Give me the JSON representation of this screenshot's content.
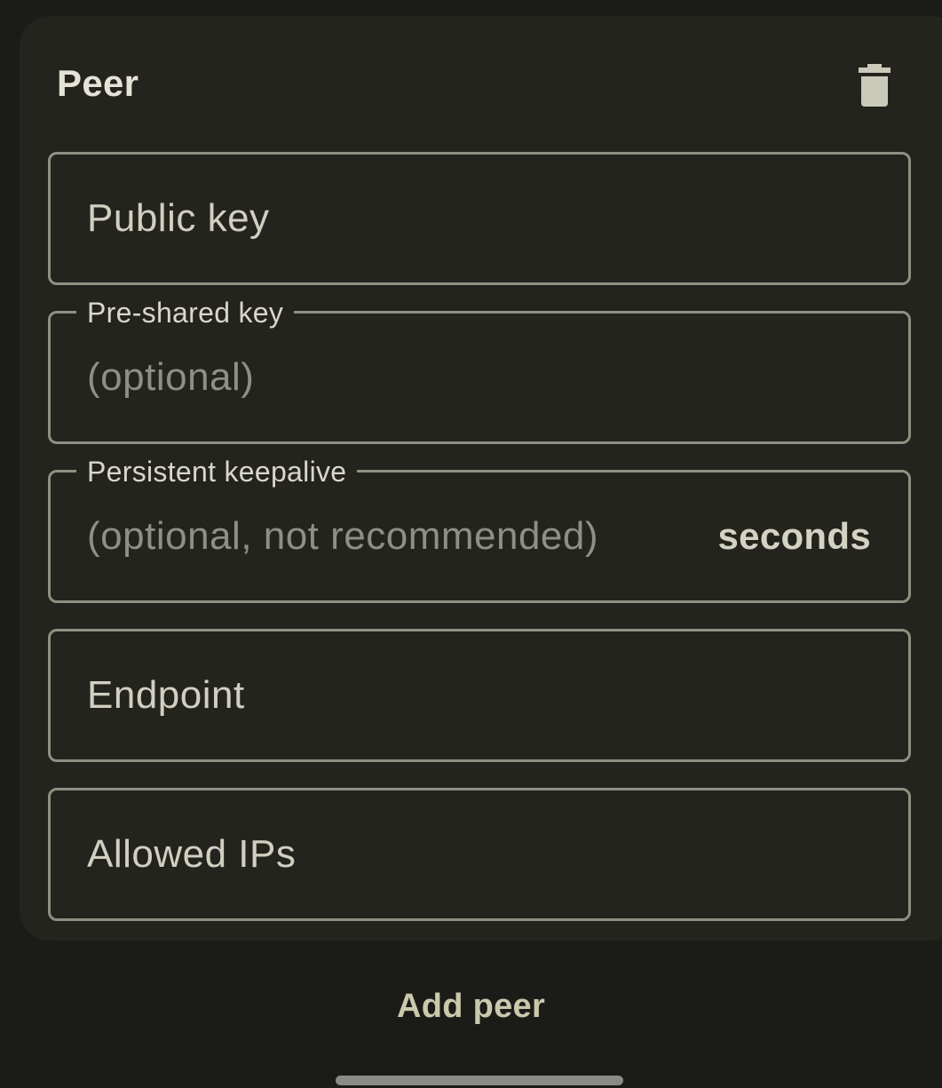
{
  "peer_card": {
    "title": "Peer",
    "delete_icon": "trash-icon",
    "fields": {
      "public_key": {
        "label": "Public key",
        "value": ""
      },
      "preshared_key": {
        "label": "Pre-shared key",
        "placeholder": "(optional)",
        "value": ""
      },
      "persistent_keepalive": {
        "label": "Persistent keepalive",
        "placeholder": "(optional, not recommended)",
        "suffix": "seconds",
        "value": ""
      },
      "endpoint": {
        "label": "Endpoint",
        "value": ""
      },
      "allowed_ips": {
        "label": "Allowed IPs",
        "value": ""
      }
    }
  },
  "actions": {
    "add_peer_label": "Add peer"
  },
  "colors": {
    "background": "#1b1c17",
    "card": "#23241e",
    "outline": "#8f9081",
    "accent_text": "#c8caad"
  }
}
